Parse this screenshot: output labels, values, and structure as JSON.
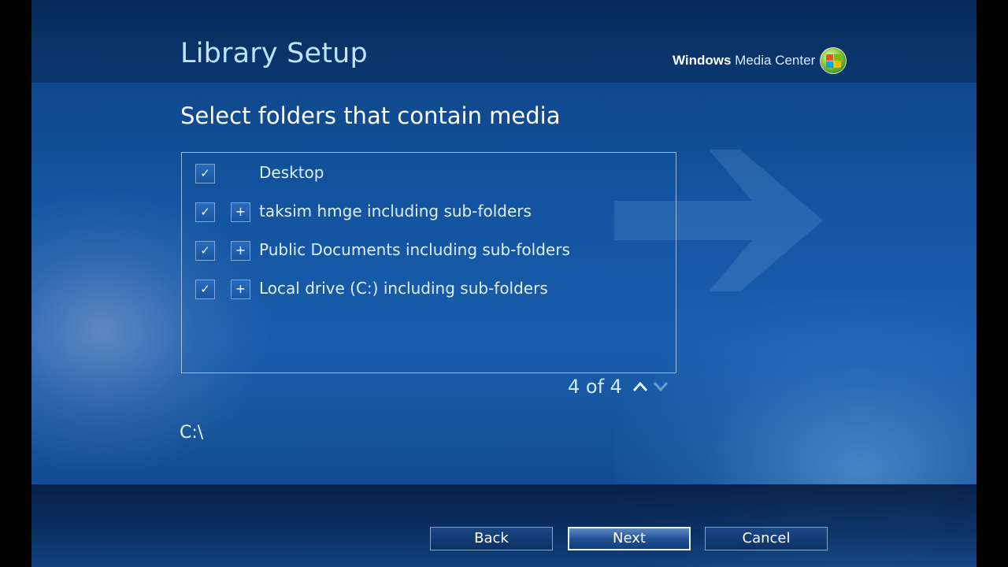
{
  "header": {
    "title": "Library Setup",
    "brand_bold": "Windows",
    "brand_rest": " Media Center"
  },
  "subtitle": "Select folders that contain media",
  "folders": [
    {
      "label": "Desktop",
      "checked": true,
      "expandable": false
    },
    {
      "label": "taksim hmge including sub-folders",
      "checked": true,
      "expandable": true
    },
    {
      "label": "Public Documents including sub-folders",
      "checked": true,
      "expandable": true
    },
    {
      "label": "Local drive (C:) including sub-folders",
      "checked": true,
      "expandable": true
    }
  ],
  "glyphs": {
    "check": "✓",
    "plus": "+"
  },
  "pager": {
    "text": "4 of 4"
  },
  "current_path": "C:\\",
  "buttons": {
    "back": "Back",
    "next": "Next",
    "cancel": "Cancel"
  },
  "colors": {
    "accent_text": "#bfe2ff",
    "background": "#1454a0"
  },
  "icons": {
    "up": "chevron-up-icon",
    "down": "chevron-down-icon",
    "logo": "windows-logo-icon"
  }
}
